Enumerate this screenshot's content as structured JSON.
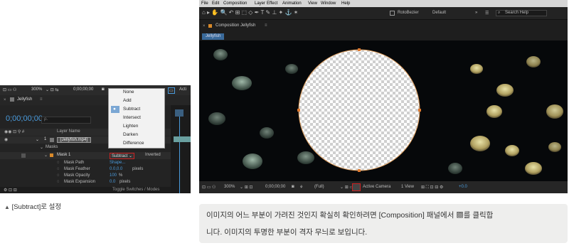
{
  "left_panel": {
    "toolbar": {
      "zoom": "300%",
      "timecode": "0;00;00;00",
      "active": "Acti"
    },
    "tab_title": "Jellyfish",
    "timecode": "0;00;00;00",
    "search_placeholder": "ρ.",
    "col_layer_name": "Layer Name",
    "layer": {
      "num": "1",
      "name": "[Jellyfish.mp4]"
    },
    "masks_label": "Masks",
    "mask": {
      "name": "Mask 1",
      "mode": "Subtract",
      "inverted": "Inverted"
    },
    "props": [
      {
        "name": "Mask Path",
        "value": "Shape..."
      },
      {
        "name": "Mask Feather",
        "value": "0.0,0.0",
        "unit": "pixels"
      },
      {
        "name": "Mask Opacity",
        "value": "100",
        "unit": "%"
      },
      {
        "name": "Mask Expansion",
        "value": "0.0",
        "unit": "pixels"
      }
    ],
    "footer": "Toggle Switches / Modes",
    "dropdown": [
      "None",
      "Add",
      "Subtract",
      "Intersect",
      "Lighten",
      "Darken",
      "Difference"
    ]
  },
  "left_caption": "[Subtract]로 설정",
  "app": {
    "menu": [
      "File",
      "Edit",
      "Composition",
      "Layer",
      "Effect",
      "Animation",
      "View",
      "Window",
      "Help"
    ],
    "toolbar": {
      "roto": "RotoBezier",
      "workspace": "Default",
      "search": "Search Help"
    },
    "panel_title": "Composition Jellyfish",
    "tab": "Jellyfish",
    "bottom": {
      "zoom": "300%",
      "timecode": "0;00;00;00",
      "res": "(Full)",
      "camera": "Active Camera",
      "views": "1 View",
      "offset": "+0.0"
    }
  },
  "note": "이미지의 어느 부분이 가려진 것인지 확실히 확인하려면 [Composition] 패널에서 ▩를 클릭합니다. 이미지의 투명한 부분이 격자 무늬로 보입니다.",
  "note_lines": [
    "이미지의 어느 부분이 가려진 것인지 확실히 확인하려면 [Composition] 패널에서 ▩를 클릭합",
    "니다. 이미지의 투명한 부분이 격자 무늬로 보입니다."
  ],
  "colors": {
    "accent": "#4a9bdc",
    "highlight": "#cc2222",
    "mask_stroke": "#e0a060"
  }
}
